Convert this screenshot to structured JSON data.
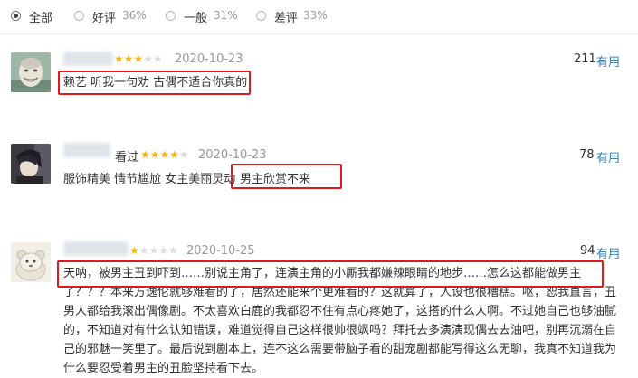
{
  "filters": [
    {
      "label": "全部",
      "pct": "",
      "selected": true
    },
    {
      "label": "好评",
      "pct": "36%",
      "selected": false
    },
    {
      "label": "一般",
      "pct": "31%",
      "selected": false
    },
    {
      "label": "差评",
      "pct": "33%",
      "selected": false
    }
  ],
  "reviews": [
    {
      "status": "",
      "rating_stars": 3,
      "date": "2020-10-23",
      "votes": "211",
      "useful_label": "有用",
      "text": "赖艺 听我一句劝 古偶不适合你真的"
    },
    {
      "status": "看过",
      "rating_stars": 4,
      "date": "2020-10-23",
      "votes": "78",
      "useful_label": "有用",
      "text_part1": "服饰精美 情节尴尬 女主美丽灵动",
      "text_part2": "男主欣赏不来"
    },
    {
      "status": "",
      "rating_stars": 1,
      "date": "2020-10-25",
      "votes": "94",
      "useful_label": "有用",
      "line1": "天呐，被男主丑到吓到……别说主角了，连演主角的小厮我都嫌辣眼睛的地步……怎么这都能做男主",
      "line2": "了？？？本来方逸伦就够难看的了，居然还能来个更难看的？这就算了，人设也很糟糕。呕，恕我直言，丑",
      "line3": "男人都给我滚出偶像剧。不太喜欢白鹿的我都忍不住有点心疼她了，这搭的什么人啊。不过她自己也够油腻",
      "line4": "的，不知道对有什么认知错误，难道觉得自己这样很帅很飒吗？拜托去多演演现偶去去油吧，别再沉溺在自",
      "line5": "己的邪魅一笑里了。最后说到剧本上，连不这么需要带脑子看的甜宠剧都能写得这么无聊，我真不知道我为",
      "line6": "什么要忍受着男主的丑脸坚持看下去。"
    }
  ],
  "colors": {
    "link": "#3377aa",
    "star": "#f5b61c",
    "highlight": "#e0191f"
  }
}
